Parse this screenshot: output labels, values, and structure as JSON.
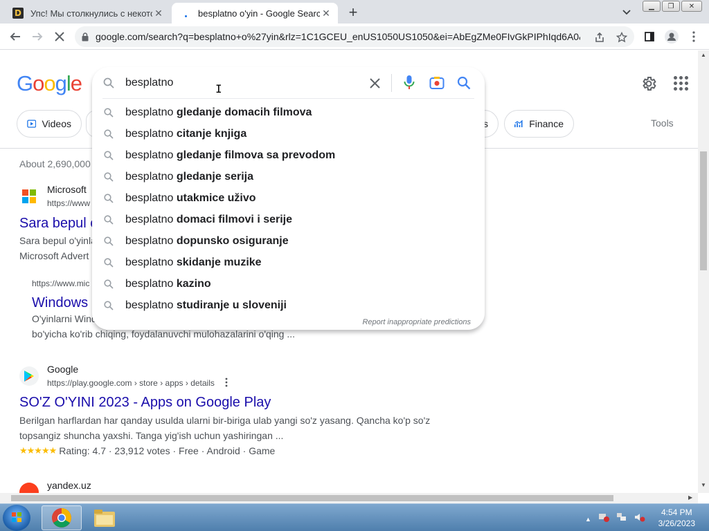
{
  "browser": {
    "tabs": [
      {
        "title": "Упс! Мы столкнулись с некоторыми",
        "favicon": "d-letter-icon"
      },
      {
        "title": "besplatno o'yin - Google Search",
        "favicon": "loading-icon",
        "active": true
      }
    ],
    "url": "google.com/search?q=besplatno+o%27yin&rlz=1C1GCEU_enUS1050US1050&ei=AbEgZMe0FIvGkPIPhIqd6A0&..."
  },
  "google": {
    "logo": "Google",
    "search_query": "besplatno",
    "chips": [
      "Videos",
      "s",
      "Finance"
    ],
    "tools_label": "Tools",
    "stats": "About 2,690,000",
    "suggestions": [
      {
        "prefix": "besplatno ",
        "bold": "gledanje domacih filmova"
      },
      {
        "prefix": "besplatno ",
        "bold": "citanje knjiga"
      },
      {
        "prefix": "besplatno ",
        "bold": "gledanje filmova sa prevodom"
      },
      {
        "prefix": "besplatno ",
        "bold": "gledanje serija"
      },
      {
        "prefix": "besplatno ",
        "bold": "utakmice uživo"
      },
      {
        "prefix": "besplatno ",
        "bold": "domaci filmovi i serije"
      },
      {
        "prefix": "besplatno ",
        "bold": "dopunsko osiguranje"
      },
      {
        "prefix": "besplatno ",
        "bold": "skidanje muzike"
      },
      {
        "prefix": "besplatno ",
        "bold": "kazino"
      },
      {
        "prefix": "besplatno ",
        "bold": "studiranje u sloveniji"
      }
    ],
    "report_label": "Report inappropriate predictions",
    "results": {
      "r1": {
        "source": "Microsoft",
        "url": "https://www",
        "title": "Sara bepul o",
        "snippet1": "Sara bepul o'yinla",
        "snippet2": "Microsoft Advert"
      },
      "r1_sub": {
        "url": "https://www.mic",
        "title": "Windows",
        "snippet1": "O'yinlarni Wind",
        "snippet2": "bo'yicha ko'rib chiqing, foydalanuvchi mulohazalarini o'qing ..."
      },
      "r2": {
        "source": "Google",
        "url": "https://play.google.com › store › apps › details",
        "title": "SO'Z O'YINI 2023 - Apps on Google Play",
        "snippet1": "Berilgan harflardan har qanday usulda ularni bir-biriga ulab yangi so'z yasang. Qancha ko'p so'z",
        "snippet2": "topsangiz shuncha yaxshi. Tanga yig'ish uchun yashiringan ...",
        "rating": 4.7,
        "rating_text": "Rating: 4.7 · 23,912 votes · Free · Android · Game"
      },
      "r3": {
        "source": "yandex.uz"
      }
    }
  },
  "taskbar": {
    "time": "4:54 PM",
    "date": "3/26/2023"
  },
  "colors": {
    "link": "#1a0dab",
    "google_blue": "#4285F4",
    "google_red": "#EA4335",
    "google_yellow": "#FBBC05",
    "google_green": "#34A853"
  }
}
